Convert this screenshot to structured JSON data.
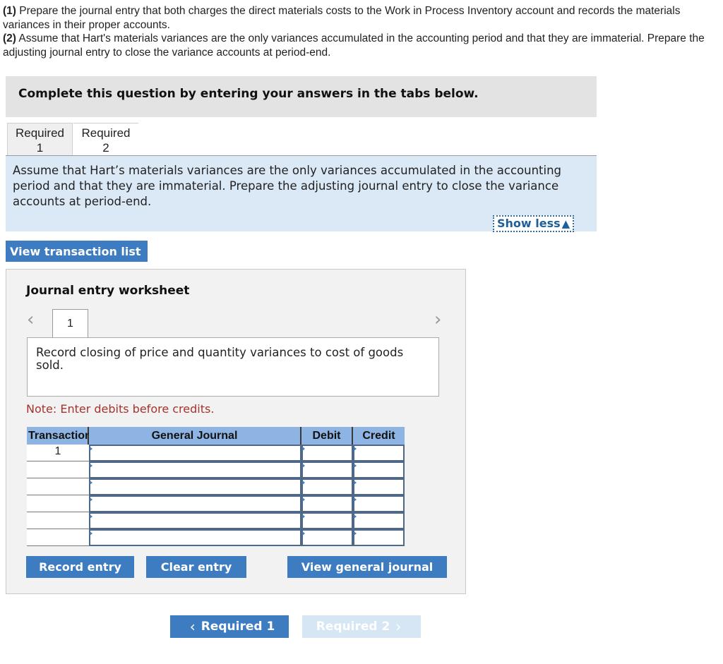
{
  "intro": {
    "part1_label": "(1)",
    "part1_text": " Prepare the journal entry that both charges the direct materials costs to the Work in Process Inventory account and records the materials variances in their proper accounts.",
    "part2_label": "(2)",
    "part2_text": " Assume that Hart's materials variances are the only variances accumulated in the accounting period and that they are immaterial. Prepare the adjusting journal entry to close the variance accounts at period-end."
  },
  "instruction": "Complete this question by entering your answers in the tabs below.",
  "tabs": [
    {
      "line1": "Required",
      "line2": "1",
      "active": false
    },
    {
      "line1": "Required",
      "line2": "2",
      "active": true
    }
  ],
  "question_text": "Assume that Hart’s materials variances are the only variances accumulated in the accounting period and that they are immaterial. Prepare the adjusting journal entry to close the variance accounts at period-end.",
  "show_less": {
    "label": "Show less",
    "icon": "triangle-up-icon"
  },
  "view_transaction_list": "View transaction list",
  "worksheet": {
    "title": "Journal entry worksheet",
    "page": "1",
    "entry_description": "Record closing of price and quantity variances to cost of goods sold.",
    "note": "Note: Enter debits before credits.",
    "columns": [
      "Transaction",
      "General Journal",
      "Debit",
      "Credit"
    ],
    "rows": [
      {
        "transaction": "1",
        "account": "",
        "debit": "",
        "credit": ""
      },
      {
        "transaction": "",
        "account": "",
        "debit": "",
        "credit": ""
      },
      {
        "transaction": "",
        "account": "",
        "debit": "",
        "credit": ""
      },
      {
        "transaction": "",
        "account": "",
        "debit": "",
        "credit": ""
      },
      {
        "transaction": "",
        "account": "",
        "debit": "",
        "credit": ""
      },
      {
        "transaction": "",
        "account": "",
        "debit": "",
        "credit": ""
      }
    ],
    "buttons": {
      "record": "Record entry",
      "clear": "Clear entry",
      "view_general_journal": "View general journal"
    }
  },
  "bottom_nav": {
    "prev_label": "Required 1",
    "next_label": "Required 2"
  },
  "colors": {
    "accent": "#3d7cc0",
    "panel_blue": "#dbe9f7",
    "header_blue": "#8db4e2",
    "note_red": "#a4332b",
    "disabled_blue": "#d6e6f5"
  }
}
